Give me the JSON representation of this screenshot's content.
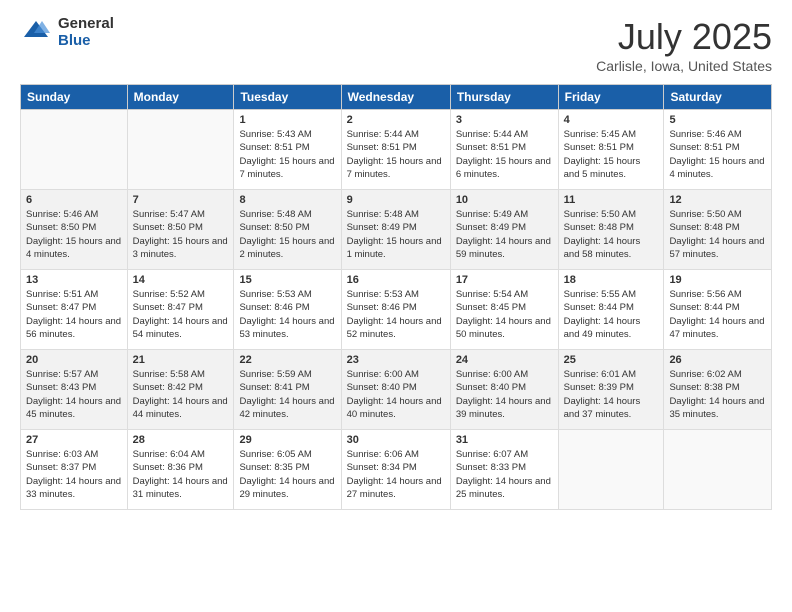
{
  "logo": {
    "general": "General",
    "blue": "Blue"
  },
  "title": "July 2025",
  "location": "Carlisle, Iowa, United States",
  "days_of_week": [
    "Sunday",
    "Monday",
    "Tuesday",
    "Wednesday",
    "Thursday",
    "Friday",
    "Saturday"
  ],
  "weeks": [
    [
      {
        "day": "",
        "info": ""
      },
      {
        "day": "",
        "info": ""
      },
      {
        "day": "1",
        "info": "Sunrise: 5:43 AM\nSunset: 8:51 PM\nDaylight: 15 hours and 7 minutes."
      },
      {
        "day": "2",
        "info": "Sunrise: 5:44 AM\nSunset: 8:51 PM\nDaylight: 15 hours and 7 minutes."
      },
      {
        "day": "3",
        "info": "Sunrise: 5:44 AM\nSunset: 8:51 PM\nDaylight: 15 hours and 6 minutes."
      },
      {
        "day": "4",
        "info": "Sunrise: 5:45 AM\nSunset: 8:51 PM\nDaylight: 15 hours and 5 minutes."
      },
      {
        "day": "5",
        "info": "Sunrise: 5:46 AM\nSunset: 8:51 PM\nDaylight: 15 hours and 4 minutes."
      }
    ],
    [
      {
        "day": "6",
        "info": "Sunrise: 5:46 AM\nSunset: 8:50 PM\nDaylight: 15 hours and 4 minutes."
      },
      {
        "day": "7",
        "info": "Sunrise: 5:47 AM\nSunset: 8:50 PM\nDaylight: 15 hours and 3 minutes."
      },
      {
        "day": "8",
        "info": "Sunrise: 5:48 AM\nSunset: 8:50 PM\nDaylight: 15 hours and 2 minutes."
      },
      {
        "day": "9",
        "info": "Sunrise: 5:48 AM\nSunset: 8:49 PM\nDaylight: 15 hours and 1 minute."
      },
      {
        "day": "10",
        "info": "Sunrise: 5:49 AM\nSunset: 8:49 PM\nDaylight: 14 hours and 59 minutes."
      },
      {
        "day": "11",
        "info": "Sunrise: 5:50 AM\nSunset: 8:48 PM\nDaylight: 14 hours and 58 minutes."
      },
      {
        "day": "12",
        "info": "Sunrise: 5:50 AM\nSunset: 8:48 PM\nDaylight: 14 hours and 57 minutes."
      }
    ],
    [
      {
        "day": "13",
        "info": "Sunrise: 5:51 AM\nSunset: 8:47 PM\nDaylight: 14 hours and 56 minutes."
      },
      {
        "day": "14",
        "info": "Sunrise: 5:52 AM\nSunset: 8:47 PM\nDaylight: 14 hours and 54 minutes."
      },
      {
        "day": "15",
        "info": "Sunrise: 5:53 AM\nSunset: 8:46 PM\nDaylight: 14 hours and 53 minutes."
      },
      {
        "day": "16",
        "info": "Sunrise: 5:53 AM\nSunset: 8:46 PM\nDaylight: 14 hours and 52 minutes."
      },
      {
        "day": "17",
        "info": "Sunrise: 5:54 AM\nSunset: 8:45 PM\nDaylight: 14 hours and 50 minutes."
      },
      {
        "day": "18",
        "info": "Sunrise: 5:55 AM\nSunset: 8:44 PM\nDaylight: 14 hours and 49 minutes."
      },
      {
        "day": "19",
        "info": "Sunrise: 5:56 AM\nSunset: 8:44 PM\nDaylight: 14 hours and 47 minutes."
      }
    ],
    [
      {
        "day": "20",
        "info": "Sunrise: 5:57 AM\nSunset: 8:43 PM\nDaylight: 14 hours and 45 minutes."
      },
      {
        "day": "21",
        "info": "Sunrise: 5:58 AM\nSunset: 8:42 PM\nDaylight: 14 hours and 44 minutes."
      },
      {
        "day": "22",
        "info": "Sunrise: 5:59 AM\nSunset: 8:41 PM\nDaylight: 14 hours and 42 minutes."
      },
      {
        "day": "23",
        "info": "Sunrise: 6:00 AM\nSunset: 8:40 PM\nDaylight: 14 hours and 40 minutes."
      },
      {
        "day": "24",
        "info": "Sunrise: 6:00 AM\nSunset: 8:40 PM\nDaylight: 14 hours and 39 minutes."
      },
      {
        "day": "25",
        "info": "Sunrise: 6:01 AM\nSunset: 8:39 PM\nDaylight: 14 hours and 37 minutes."
      },
      {
        "day": "26",
        "info": "Sunrise: 6:02 AM\nSunset: 8:38 PM\nDaylight: 14 hours and 35 minutes."
      }
    ],
    [
      {
        "day": "27",
        "info": "Sunrise: 6:03 AM\nSunset: 8:37 PM\nDaylight: 14 hours and 33 minutes."
      },
      {
        "day": "28",
        "info": "Sunrise: 6:04 AM\nSunset: 8:36 PM\nDaylight: 14 hours and 31 minutes."
      },
      {
        "day": "29",
        "info": "Sunrise: 6:05 AM\nSunset: 8:35 PM\nDaylight: 14 hours and 29 minutes."
      },
      {
        "day": "30",
        "info": "Sunrise: 6:06 AM\nSunset: 8:34 PM\nDaylight: 14 hours and 27 minutes."
      },
      {
        "day": "31",
        "info": "Sunrise: 6:07 AM\nSunset: 8:33 PM\nDaylight: 14 hours and 25 minutes."
      },
      {
        "day": "",
        "info": ""
      },
      {
        "day": "",
        "info": ""
      }
    ]
  ]
}
